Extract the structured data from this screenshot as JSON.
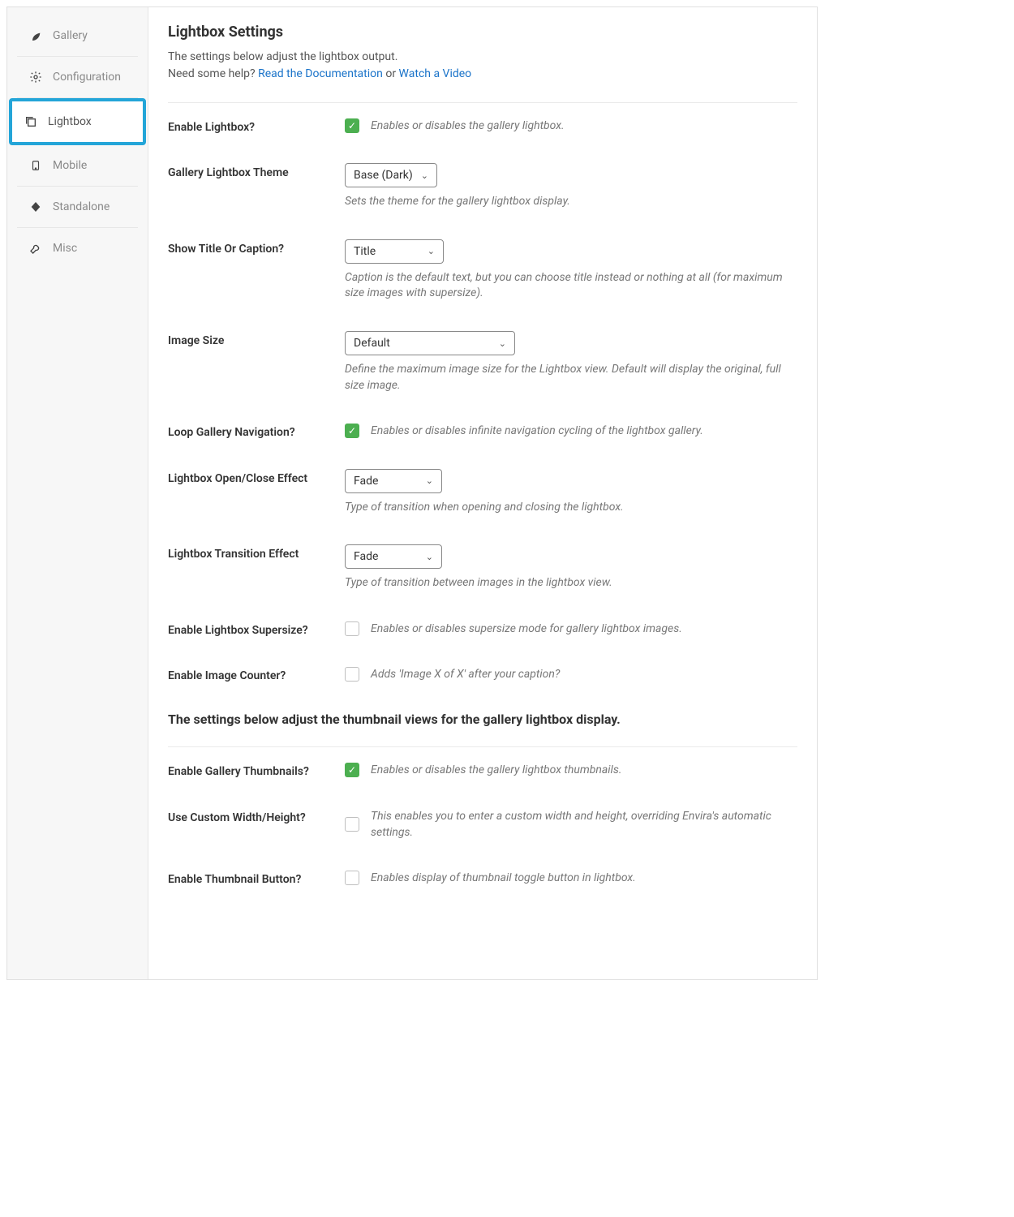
{
  "sidebar": {
    "items": [
      {
        "label": "Gallery"
      },
      {
        "label": "Configuration"
      },
      {
        "label": "Lightbox"
      },
      {
        "label": "Mobile"
      },
      {
        "label": "Standalone"
      },
      {
        "label": "Misc"
      }
    ]
  },
  "header": {
    "title": "Lightbox Settings",
    "sub1": "The settings below adjust the lightbox output.",
    "sub2_prefix": "Need some help? ",
    "doc_link": "Read the Documentation",
    "or": " or ",
    "video_link": "Watch a Video"
  },
  "settings": {
    "enable_lightbox": {
      "label": "Enable Lightbox?",
      "desc": "Enables or disables the gallery lightbox."
    },
    "theme": {
      "label": "Gallery Lightbox Theme",
      "value": "Base (Dark)",
      "desc": "Sets the theme for the gallery lightbox display."
    },
    "title_caption": {
      "label": "Show Title Or Caption?",
      "value": "Title",
      "desc": "Caption is the default text, but you can choose title instead or nothing at all (for maximum size images with supersize)."
    },
    "image_size": {
      "label": "Image Size",
      "value": "Default",
      "desc": "Define the maximum image size for the Lightbox view. Default will display the original, full size image."
    },
    "loop": {
      "label": "Loop Gallery Navigation?",
      "desc": "Enables or disables infinite navigation cycling of the lightbox gallery."
    },
    "open_effect": {
      "label": "Lightbox Open/Close Effect",
      "value": "Fade",
      "desc": "Type of transition when opening and closing the lightbox."
    },
    "transition_effect": {
      "label": "Lightbox Transition Effect",
      "value": "Fade",
      "desc": "Type of transition between images in the lightbox view."
    },
    "supersize": {
      "label": "Enable Lightbox Supersize?",
      "desc": "Enables or disables supersize mode for gallery lightbox images."
    },
    "counter": {
      "label": "Enable Image Counter?",
      "desc": "Adds 'Image X of X' after your caption?"
    }
  },
  "thumbnails": {
    "heading": "The settings below adjust the thumbnail views for the gallery lightbox display.",
    "enable": {
      "label": "Enable Gallery Thumbnails?",
      "desc": "Enables or disables the gallery lightbox thumbnails."
    },
    "custom_wh": {
      "label": "Use Custom Width/Height?",
      "desc": "This enables you to enter a custom width and height, overriding Envira's automatic settings."
    },
    "button": {
      "label": "Enable Thumbnail Button?",
      "desc": "Enables display of thumbnail toggle button in lightbox."
    }
  }
}
